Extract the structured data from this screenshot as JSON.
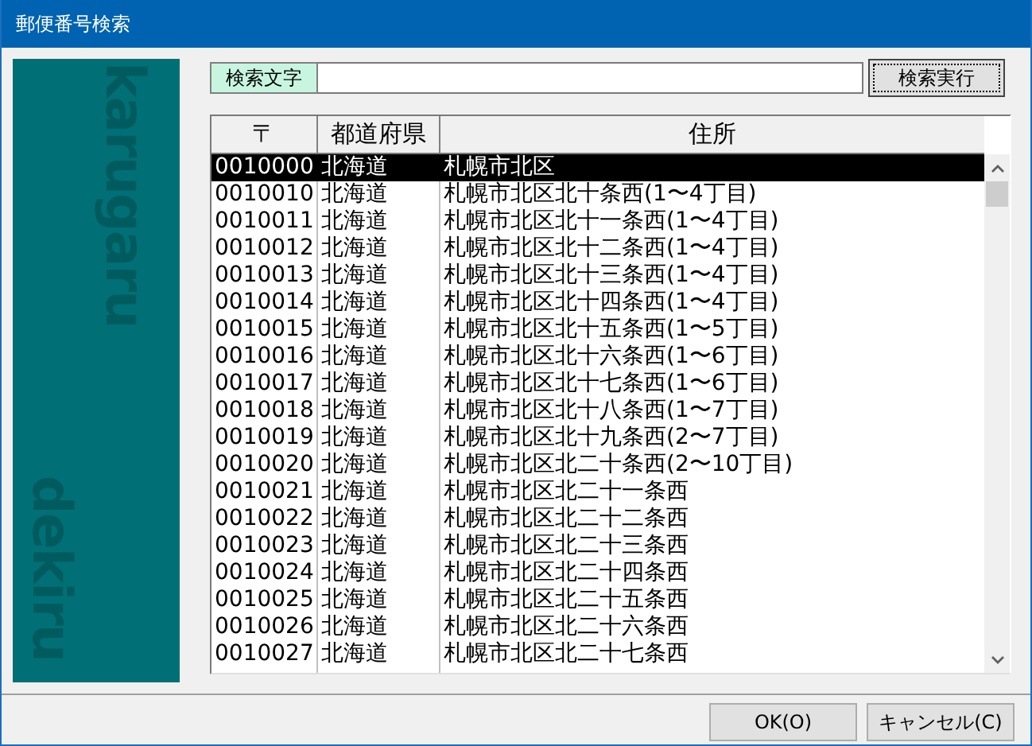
{
  "window": {
    "title": "郵便番号検索"
  },
  "side_panel": {
    "top_text": "karugaru",
    "bottom_text": "dekiru"
  },
  "search": {
    "label": "検索文字",
    "button": "検索実行"
  },
  "table": {
    "columns": [
      "〒",
      "都道府県",
      "住所"
    ],
    "rows": [
      {
        "zip": "0010000",
        "pref": "北海道",
        "address": "札幌市北区",
        "selected": true
      },
      {
        "zip": "0010010",
        "pref": "北海道",
        "address": "札幌市北区北十条西(1〜4丁目)",
        "selected": false
      },
      {
        "zip": "0010011",
        "pref": "北海道",
        "address": "札幌市北区北十一条西(1〜4丁目)",
        "selected": false
      },
      {
        "zip": "0010012",
        "pref": "北海道",
        "address": "札幌市北区北十二条西(1〜4丁目)",
        "selected": false
      },
      {
        "zip": "0010013",
        "pref": "北海道",
        "address": "札幌市北区北十三条西(1〜4丁目)",
        "selected": false
      },
      {
        "zip": "0010014",
        "pref": "北海道",
        "address": "札幌市北区北十四条西(1〜4丁目)",
        "selected": false
      },
      {
        "zip": "0010015",
        "pref": "北海道",
        "address": "札幌市北区北十五条西(1〜5丁目)",
        "selected": false
      },
      {
        "zip": "0010016",
        "pref": "北海道",
        "address": "札幌市北区北十六条西(1〜6丁目)",
        "selected": false
      },
      {
        "zip": "0010017",
        "pref": "北海道",
        "address": "札幌市北区北十七条西(1〜6丁目)",
        "selected": false
      },
      {
        "zip": "0010018",
        "pref": "北海道",
        "address": "札幌市北区北十八条西(1〜7丁目)",
        "selected": false
      },
      {
        "zip": "0010019",
        "pref": "北海道",
        "address": "札幌市北区北十九条西(2〜7丁目)",
        "selected": false
      },
      {
        "zip": "0010020",
        "pref": "北海道",
        "address": "札幌市北区北二十条西(2〜10丁目)",
        "selected": false
      },
      {
        "zip": "0010021",
        "pref": "北海道",
        "address": "札幌市北区北二十一条西",
        "selected": false
      },
      {
        "zip": "0010022",
        "pref": "北海道",
        "address": "札幌市北区北二十二条西",
        "selected": false
      },
      {
        "zip": "0010023",
        "pref": "北海道",
        "address": "札幌市北区北二十三条西",
        "selected": false
      },
      {
        "zip": "0010024",
        "pref": "北海道",
        "address": "札幌市北区北二十四条西",
        "selected": false
      },
      {
        "zip": "0010025",
        "pref": "北海道",
        "address": "札幌市北区北二十五条西",
        "selected": false
      },
      {
        "zip": "0010026",
        "pref": "北海道",
        "address": "札幌市北区北二十六条西",
        "selected": false
      },
      {
        "zip": "0010027",
        "pref": "北海道",
        "address": "札幌市北区北二十七条西",
        "selected": false
      }
    ]
  },
  "buttons": [
    "OK(O)",
    "キャンセル(C)"
  ]
}
